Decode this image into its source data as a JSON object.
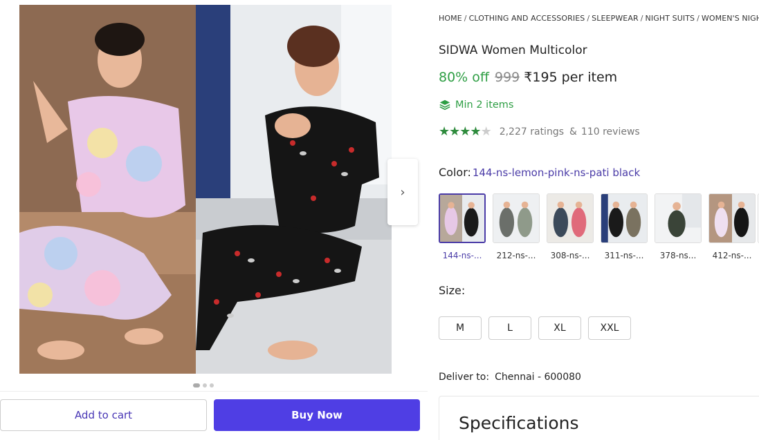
{
  "breadcrumb": {
    "items": [
      "HOME",
      "CLOTHING AND ACCESSORIES",
      "SLEEPWEAR",
      "NIGHT SUITS",
      "WOMEN'S NIGHT"
    ],
    "separator": "/"
  },
  "product": {
    "title": "SIDWA Women Multicolor",
    "discount": "80% off",
    "mrp": "999",
    "price": "₹195 per item",
    "min_items": "Min 2 items"
  },
  "ratings": {
    "stars_filled": 4,
    "stars_total": 5,
    "ratings_text": "2,227 ratings",
    "ampersand": "&",
    "reviews_text": "110 reviews"
  },
  "color": {
    "label": "Color:",
    "selected_value": "144-ns-lemon-pink-ns-pati black",
    "variants": [
      {
        "label": "144-ns-..."
      },
      {
        "label": "212-ns-..."
      },
      {
        "label": "308-ns-..."
      },
      {
        "label": "311-ns-..."
      },
      {
        "label": "378-ns..."
      },
      {
        "label": "412-ns-..."
      }
    ]
  },
  "size": {
    "label": "Size:",
    "options": [
      "M",
      "L",
      "XL",
      "XXL"
    ]
  },
  "delivery": {
    "label": "Deliver to:",
    "location": "Chennai - 600080"
  },
  "specifications": {
    "title": "Specifications"
  },
  "actions": {
    "add_to_cart": "Add to cart",
    "buy_now": "Buy Now"
  },
  "gallery": {
    "next_icon": "chevron-right-icon",
    "slide_count": 3,
    "active_slide": 1
  },
  "colors": {
    "brand": "#4f3ee4",
    "discount_green": "#2e9e44",
    "star_green": "#2e8b3d",
    "link_purple": "#4a3ba7"
  }
}
